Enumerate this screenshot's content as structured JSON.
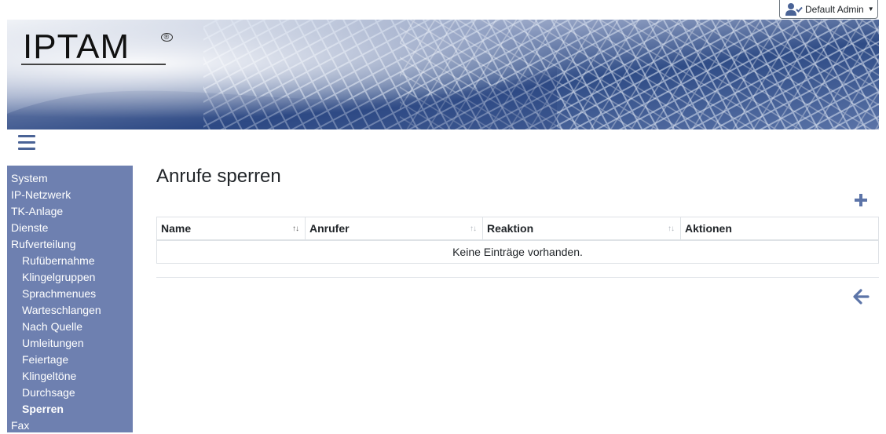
{
  "user_menu": {
    "label": "Default Admin"
  },
  "banner": {
    "logo_text": "IPTAM",
    "logo_mark": "®"
  },
  "sidebar": {
    "items": [
      {
        "label": "System",
        "level": 0
      },
      {
        "label": "IP-Netzwerk",
        "level": 0
      },
      {
        "label": "TK-Anlage",
        "level": 0
      },
      {
        "label": "Dienste",
        "level": 0
      },
      {
        "label": "Rufverteilung",
        "level": 0
      },
      {
        "label": "Rufübernahme",
        "level": 1
      },
      {
        "label": "Klingelgruppen",
        "level": 1
      },
      {
        "label": "Sprachmenues",
        "level": 1
      },
      {
        "label": "Warteschlangen",
        "level": 1
      },
      {
        "label": "Nach Quelle",
        "level": 1
      },
      {
        "label": "Umleitungen",
        "level": 1
      },
      {
        "label": "Feiertage",
        "level": 1
      },
      {
        "label": "Klingeltöne",
        "level": 1
      },
      {
        "label": "Durchsage",
        "level": 1
      },
      {
        "label": "Sperren",
        "level": 1,
        "active": true
      },
      {
        "label": "Fax",
        "level": 0
      }
    ]
  },
  "main": {
    "title": "Anrufe sperren",
    "table": {
      "columns": [
        "Name",
        "Anrufer",
        "Reaktion",
        "Aktionen"
      ],
      "empty_text": "Keine Einträge vorhanden."
    }
  },
  "colors": {
    "sidebar_bg": "#6e80b0",
    "accent": "#4a6396"
  },
  "icons": {
    "user": "user-check-icon",
    "add": "plus-icon",
    "back": "arrow-left-icon",
    "menu": "hamburger-icon"
  }
}
